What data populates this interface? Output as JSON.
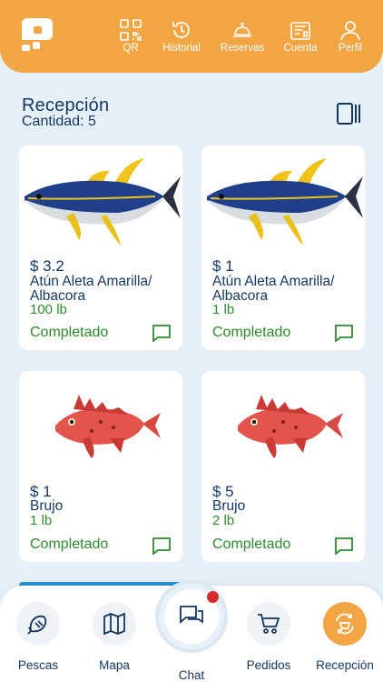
{
  "header": {
    "nav": [
      {
        "label": "QR",
        "icon": "qr-icon"
      },
      {
        "label": "Historial",
        "icon": "history-icon"
      },
      {
        "label": "Reservas",
        "icon": "cloche-icon"
      },
      {
        "label": "Cuenta",
        "icon": "account-icon"
      },
      {
        "label": "Perfil",
        "icon": "profile-icon"
      }
    ]
  },
  "page": {
    "title": "Recepción",
    "count_label": "Cantidad: 5"
  },
  "cards": [
    {
      "price": "$ 3.2",
      "name": "Atún Aleta Amarilla/ Albacora",
      "qty": "100 lb",
      "status": "Completado",
      "fish": "tuna"
    },
    {
      "price": "$ 1",
      "name": "Atún Aleta Amarilla/ Albacora",
      "qty": "1 lb",
      "status": "Completado",
      "fish": "tuna"
    },
    {
      "price": "$ 1",
      "name": "Brujo",
      "qty": "1 lb",
      "status": "Completado",
      "fish": "scorpionfish"
    },
    {
      "price": "$ 5",
      "name": "Brujo",
      "qty": "2 lb",
      "status": "Completado",
      "fish": "scorpionfish"
    }
  ],
  "tabbar": {
    "pescas": "Pescas",
    "mapa": "Mapa",
    "chat": "Chat",
    "pedidos": "Pedidos",
    "recepcion": "Recepción"
  },
  "colors": {
    "accent": "#f1a543",
    "navy": "#14375f",
    "status_green": "#2e8a2e",
    "notification": "#d92b2b"
  }
}
